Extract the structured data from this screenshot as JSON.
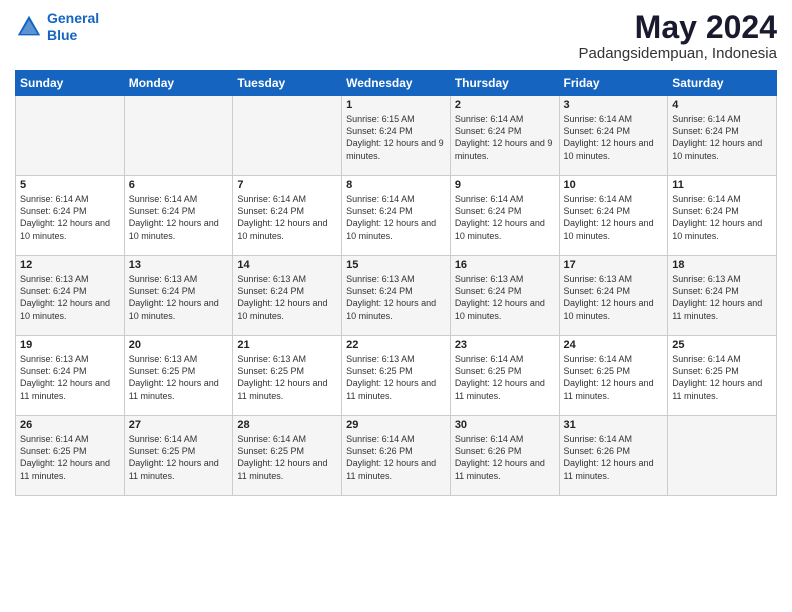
{
  "logo": {
    "line1": "General",
    "line2": "Blue"
  },
  "title": "May 2024",
  "subtitle": "Padangsidempuan, Indonesia",
  "headers": [
    "Sunday",
    "Monday",
    "Tuesday",
    "Wednesday",
    "Thursday",
    "Friday",
    "Saturday"
  ],
  "weeks": [
    [
      {
        "day": "",
        "info": ""
      },
      {
        "day": "",
        "info": ""
      },
      {
        "day": "",
        "info": ""
      },
      {
        "day": "1",
        "info": "Sunrise: 6:15 AM\nSunset: 6:24 PM\nDaylight: 12 hours\nand 9 minutes."
      },
      {
        "day": "2",
        "info": "Sunrise: 6:14 AM\nSunset: 6:24 PM\nDaylight: 12 hours\nand 9 minutes."
      },
      {
        "day": "3",
        "info": "Sunrise: 6:14 AM\nSunset: 6:24 PM\nDaylight: 12 hours\nand 10 minutes."
      },
      {
        "day": "4",
        "info": "Sunrise: 6:14 AM\nSunset: 6:24 PM\nDaylight: 12 hours\nand 10 minutes."
      }
    ],
    [
      {
        "day": "5",
        "info": "Sunrise: 6:14 AM\nSunset: 6:24 PM\nDaylight: 12 hours\nand 10 minutes."
      },
      {
        "day": "6",
        "info": "Sunrise: 6:14 AM\nSunset: 6:24 PM\nDaylight: 12 hours\nand 10 minutes."
      },
      {
        "day": "7",
        "info": "Sunrise: 6:14 AM\nSunset: 6:24 PM\nDaylight: 12 hours\nand 10 minutes."
      },
      {
        "day": "8",
        "info": "Sunrise: 6:14 AM\nSunset: 6:24 PM\nDaylight: 12 hours\nand 10 minutes."
      },
      {
        "day": "9",
        "info": "Sunrise: 6:14 AM\nSunset: 6:24 PM\nDaylight: 12 hours\nand 10 minutes."
      },
      {
        "day": "10",
        "info": "Sunrise: 6:14 AM\nSunset: 6:24 PM\nDaylight: 12 hours\nand 10 minutes."
      },
      {
        "day": "11",
        "info": "Sunrise: 6:14 AM\nSunset: 6:24 PM\nDaylight: 12 hours\nand 10 minutes."
      }
    ],
    [
      {
        "day": "12",
        "info": "Sunrise: 6:13 AM\nSunset: 6:24 PM\nDaylight: 12 hours\nand 10 minutes."
      },
      {
        "day": "13",
        "info": "Sunrise: 6:13 AM\nSunset: 6:24 PM\nDaylight: 12 hours\nand 10 minutes."
      },
      {
        "day": "14",
        "info": "Sunrise: 6:13 AM\nSunset: 6:24 PM\nDaylight: 12 hours\nand 10 minutes."
      },
      {
        "day": "15",
        "info": "Sunrise: 6:13 AM\nSunset: 6:24 PM\nDaylight: 12 hours\nand 10 minutes."
      },
      {
        "day": "16",
        "info": "Sunrise: 6:13 AM\nSunset: 6:24 PM\nDaylight: 12 hours\nand 10 minutes."
      },
      {
        "day": "17",
        "info": "Sunrise: 6:13 AM\nSunset: 6:24 PM\nDaylight: 12 hours\nand 10 minutes."
      },
      {
        "day": "18",
        "info": "Sunrise: 6:13 AM\nSunset: 6:24 PM\nDaylight: 12 hours\nand 11 minutes."
      }
    ],
    [
      {
        "day": "19",
        "info": "Sunrise: 6:13 AM\nSunset: 6:24 PM\nDaylight: 12 hours\nand 11 minutes."
      },
      {
        "day": "20",
        "info": "Sunrise: 6:13 AM\nSunset: 6:25 PM\nDaylight: 12 hours\nand 11 minutes."
      },
      {
        "day": "21",
        "info": "Sunrise: 6:13 AM\nSunset: 6:25 PM\nDaylight: 12 hours\nand 11 minutes."
      },
      {
        "day": "22",
        "info": "Sunrise: 6:13 AM\nSunset: 6:25 PM\nDaylight: 12 hours\nand 11 minutes."
      },
      {
        "day": "23",
        "info": "Sunrise: 6:14 AM\nSunset: 6:25 PM\nDaylight: 12 hours\nand 11 minutes."
      },
      {
        "day": "24",
        "info": "Sunrise: 6:14 AM\nSunset: 6:25 PM\nDaylight: 12 hours\nand 11 minutes."
      },
      {
        "day": "25",
        "info": "Sunrise: 6:14 AM\nSunset: 6:25 PM\nDaylight: 12 hours\nand 11 minutes."
      }
    ],
    [
      {
        "day": "26",
        "info": "Sunrise: 6:14 AM\nSunset: 6:25 PM\nDaylight: 12 hours\nand 11 minutes."
      },
      {
        "day": "27",
        "info": "Sunrise: 6:14 AM\nSunset: 6:25 PM\nDaylight: 12 hours\nand 11 minutes."
      },
      {
        "day": "28",
        "info": "Sunrise: 6:14 AM\nSunset: 6:25 PM\nDaylight: 12 hours\nand 11 minutes."
      },
      {
        "day": "29",
        "info": "Sunrise: 6:14 AM\nSunset: 6:26 PM\nDaylight: 12 hours\nand 11 minutes."
      },
      {
        "day": "30",
        "info": "Sunrise: 6:14 AM\nSunset: 6:26 PM\nDaylight: 12 hours\nand 11 minutes."
      },
      {
        "day": "31",
        "info": "Sunrise: 6:14 AM\nSunset: 6:26 PM\nDaylight: 12 hours\nand 11 minutes."
      },
      {
        "day": "",
        "info": ""
      }
    ]
  ]
}
